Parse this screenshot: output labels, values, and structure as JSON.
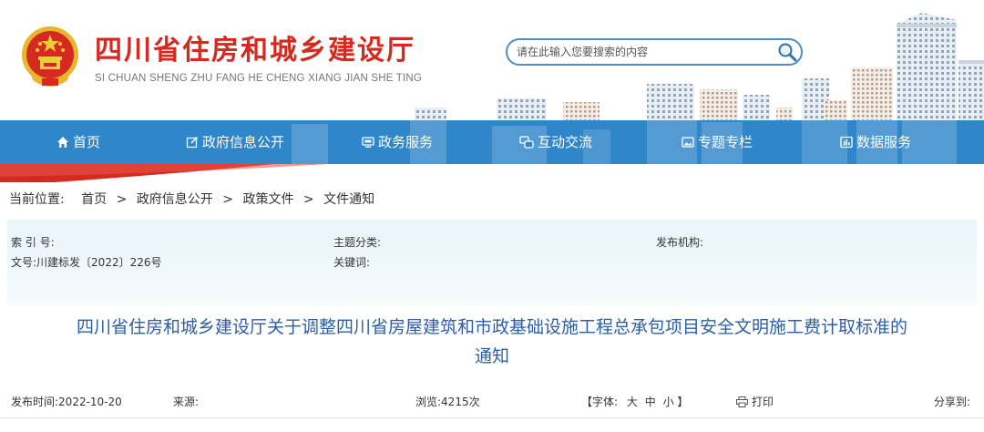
{
  "site": {
    "title": "四川省住房和城乡建设厅",
    "pinyin": "SI CHUAN SHENG ZHU FANG HE CHENG XIANG JIAN SHE TING"
  },
  "search": {
    "placeholder": "请在此输入您要搜索的内容"
  },
  "nav": {
    "items": [
      {
        "label": "首页",
        "icon": "home-icon"
      },
      {
        "label": "政府信息公开",
        "icon": "edit-icon"
      },
      {
        "label": "政务服务",
        "icon": "monitor-icon"
      },
      {
        "label": "互动交流",
        "icon": "interaction-icon"
      },
      {
        "label": "专题专栏",
        "icon": "image-icon"
      },
      {
        "label": "数据服务",
        "icon": "data-icon"
      }
    ]
  },
  "breadcrumb": {
    "prefix": "当前位置:",
    "items": [
      "首页",
      "政府信息公开",
      "政策文件",
      "文件通知"
    ],
    "separator": ">"
  },
  "meta": {
    "index_label": "索 引 号:",
    "category_label": "主题分类:",
    "publisher_label": "发布机构:",
    "doc_number": "文号:川建标发〔2022〕226号",
    "keywords_label": "关键词:"
  },
  "document": {
    "title_line1": "四川省住房和城乡建设厅关于调整四川省房屋建筑和市政基础设施工程总承包项目安全文明施工费计取标准的",
    "title_line2": "通知"
  },
  "info": {
    "date": "发布时间:2022-10-20",
    "source": "来源:",
    "views": "浏览:4215次",
    "font_label": "【字体:",
    "font_large": "大",
    "font_medium": "中",
    "font_small": "小",
    "font_close": "】",
    "print": "打印",
    "share": "分享到:"
  },
  "colors": {
    "brand_red": "#d42a1f",
    "nav_blue": "#2f86c9",
    "title_blue": "#2b5fa8"
  }
}
